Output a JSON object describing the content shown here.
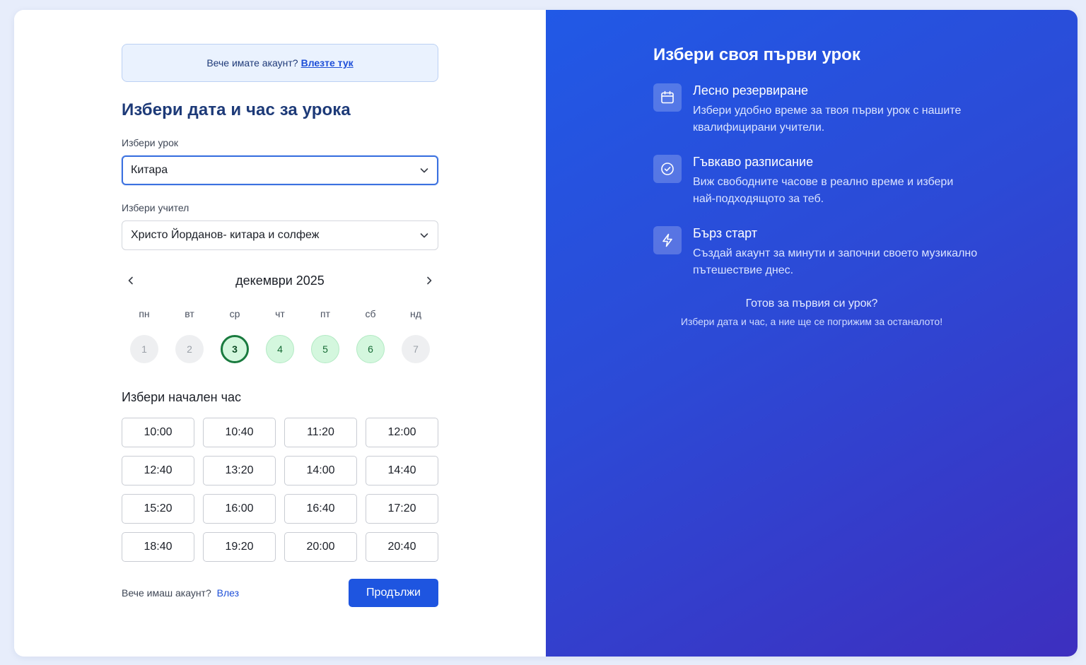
{
  "login_banner": {
    "text": "Вече имате акаунт?",
    "link": "Влезте тук"
  },
  "page_title": "Избери дата и час за урока",
  "lesson": {
    "label": "Избери урок",
    "value": "Китара"
  },
  "teacher": {
    "label": "Избери учител",
    "value": "Христо Йорданов- китара и солфеж"
  },
  "calendar": {
    "month": "декември 2025",
    "weekdays": [
      "пн",
      "вт",
      "ср",
      "чт",
      "пт",
      "сб",
      "нд"
    ],
    "days": [
      {
        "label": "1",
        "state": "disabled"
      },
      {
        "label": "2",
        "state": "disabled"
      },
      {
        "label": "3",
        "state": "selected"
      },
      {
        "label": "4",
        "state": "available"
      },
      {
        "label": "5",
        "state": "available"
      },
      {
        "label": "6",
        "state": "available"
      },
      {
        "label": "7",
        "state": "disabled"
      }
    ]
  },
  "time_section": {
    "title": "Избери начален час",
    "slots": [
      "10:00",
      "10:40",
      "11:20",
      "12:00",
      "12:40",
      "13:20",
      "14:00",
      "14:40",
      "15:20",
      "16:00",
      "16:40",
      "17:20",
      "18:40",
      "19:20",
      "20:00",
      "20:40"
    ]
  },
  "footer": {
    "text": "Вече имаш акаунт?",
    "link": "Влез",
    "continue_label": "Продължи"
  },
  "right_panel": {
    "title": "Избери своя първи урок",
    "features": [
      {
        "icon": "calendar-icon",
        "title": "Лесно резервиране",
        "desc": "Избери удобно време за твоя първи урок с нашите квалифицирани учители."
      },
      {
        "icon": "check-circle-icon",
        "title": "Гъвкаво разписание",
        "desc": "Виж свободните часове в реално време и избери най-подходящото за теб."
      },
      {
        "icon": "lightning-icon",
        "title": "Бърз старт",
        "desc": "Създай акаунт за минути и започни своето музикално пътешествие днес."
      }
    ],
    "ready_title": "Готов за първия си урок?",
    "ready_sub": "Избери дата и час, а ние ще се погрижим за останалото!"
  },
  "colors": {
    "primary": "#1e55e0",
    "title": "#1d3a78",
    "available_day": "#d4f7de",
    "selected_ring": "#197a3e",
    "gradient_start": "#2159e6",
    "gradient_end": "#3d2fbf"
  }
}
